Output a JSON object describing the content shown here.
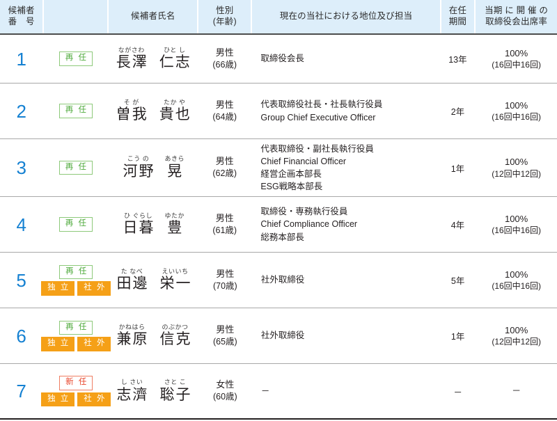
{
  "header": {
    "columns": [
      {
        "key": "number",
        "lines": [
          "候補者",
          "番　号"
        ]
      },
      {
        "key": "badges",
        "lines": [
          ""
        ]
      },
      {
        "key": "name",
        "lines": [
          "候補者氏名"
        ]
      },
      {
        "key": "gender",
        "lines": [
          "性別",
          "(年齢)"
        ]
      },
      {
        "key": "position",
        "lines": [
          "現在の当社における地位及び担当"
        ]
      },
      {
        "key": "term",
        "lines": [
          "在任",
          "期間"
        ]
      },
      {
        "key": "attendance",
        "lines": [
          "当期 に 開 催 の",
          "取締役会出席率"
        ]
      }
    ]
  },
  "badge_labels": {
    "reappoint": "再 任",
    "new": "新 任",
    "independent": "独 立",
    "outside": "社 外"
  },
  "colors": {
    "header_bg": "#ddeefa",
    "number": "#1581d2",
    "reappoint_text": "#4faa3c",
    "reappoint_border": "#8dc97a",
    "new_text": "#e8462c",
    "new_border": "#ef7d62",
    "orange_badge": "#f5a017",
    "rule": "#a8a8a8",
    "header_rule": "#4c4c4c",
    "bottom_rule": "#231f20"
  },
  "rows": [
    {
      "number": "1",
      "badges": [
        "再 任"
      ],
      "badges_second": [],
      "surname_furigana": "ながさわ",
      "surname": "長澤",
      "given_furigana": "ひと し",
      "given": "仁志",
      "gender": "男性",
      "age": "(66歳)",
      "position": [
        "取締役会長"
      ],
      "term": "13年",
      "attendance_pct": "100%",
      "attendance_detail": "(16回中16回)"
    },
    {
      "number": "2",
      "badges": [
        "再 任"
      ],
      "badges_second": [],
      "surname_furigana": "そ が",
      "surname": "曽我",
      "given_furigana": "たか や",
      "given": "貴也",
      "gender": "男性",
      "age": "(64歳)",
      "position": [
        "代表取締役社長・社長執行役員",
        "Group Chief Executive Officer"
      ],
      "term": "2年",
      "attendance_pct": "100%",
      "attendance_detail": "(16回中16回)"
    },
    {
      "number": "3",
      "badges": [
        "再 任"
      ],
      "badges_second": [],
      "surname_furigana": "こう の",
      "surname": "河野",
      "given_furigana": "あきら",
      "given": "晃",
      "gender": "男性",
      "age": "(62歳)",
      "position": [
        "代表取締役・副社長執行役員",
        "Chief Financial Officer",
        "経営企画本部長",
        "ESG戦略本部長"
      ],
      "term": "1年",
      "attendance_pct": "100%",
      "attendance_detail": "(12回中12回)"
    },
    {
      "number": "4",
      "badges": [
        "再 任"
      ],
      "badges_second": [],
      "surname_furigana": "ひ ぐらし",
      "surname": "日暮",
      "given_furigana": "ゆたか",
      "given": "豊",
      "gender": "男性",
      "age": "(61歳)",
      "position": [
        "取締役・専務執行役員",
        "Chief Compliance Officer",
        "総務本部長"
      ],
      "term": "4年",
      "attendance_pct": "100%",
      "attendance_detail": "(16回中16回)"
    },
    {
      "number": "5",
      "badges": [
        "再 任"
      ],
      "badges_second": [
        "独 立",
        "社 外"
      ],
      "surname_furigana": "た なべ",
      "surname": "田邊",
      "given_furigana": "えいいち",
      "given": "栄一",
      "gender": "男性",
      "age": "(70歳)",
      "position": [
        "社外取締役"
      ],
      "term": "5年",
      "attendance_pct": "100%",
      "attendance_detail": "(16回中16回)"
    },
    {
      "number": "6",
      "badges": [
        "再 任"
      ],
      "badges_second": [
        "独 立",
        "社 外"
      ],
      "surname_furigana": "かねはら",
      "surname": "兼原",
      "given_furigana": "のぶかつ",
      "given": "信克",
      "gender": "男性",
      "age": "(65歳)",
      "position": [
        "社外取締役"
      ],
      "term": "1年",
      "attendance_pct": "100%",
      "attendance_detail": "(12回中12回)"
    },
    {
      "number": "7",
      "badges": [
        "新 任"
      ],
      "badges_second": [
        "独 立",
        "社 外"
      ],
      "surname_furigana": "し さい",
      "surname": "志濟",
      "given_furigana": "さと こ",
      "given": "聡子",
      "gender": "女性",
      "age": "(60歳)",
      "position": [
        "－"
      ],
      "term": "－",
      "attendance_pct": "－",
      "attendance_detail": ""
    }
  ]
}
